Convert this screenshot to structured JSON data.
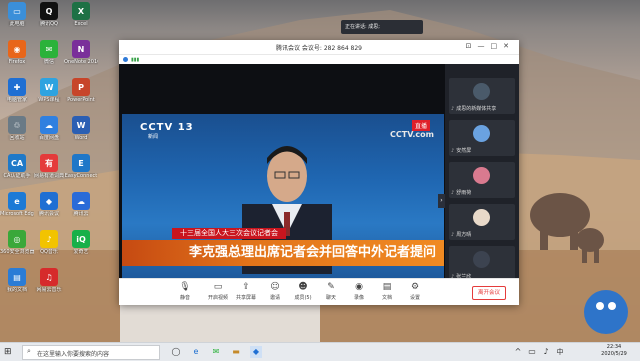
{
  "desktop_icons": [
    {
      "label": "此电脑",
      "glyph": "▭",
      "color": "#3b8fd9"
    },
    {
      "label": "腾讯QQ",
      "glyph": "Q",
      "color": "#111"
    },
    {
      "label": "Excel",
      "glyph": "X",
      "color": "#1e7145"
    },
    {
      "label": "Firefox",
      "glyph": "◉",
      "color": "#e8661a"
    },
    {
      "label": "微信",
      "glyph": "✉",
      "color": "#2bb23a"
    },
    {
      "label": "OneNote 2016",
      "glyph": "N",
      "color": "#7a2f9a"
    },
    {
      "label": "电脑管家",
      "glyph": "✚",
      "color": "#1f6fd3"
    },
    {
      "label": "WPS课程",
      "glyph": "W",
      "color": "#2ea3e0"
    },
    {
      "label": "PowerPoint",
      "glyph": "P",
      "color": "#c7452a"
    },
    {
      "label": "回收站",
      "glyph": "♲",
      "color": "#6a7a86"
    },
    {
      "label": "百度网盘",
      "glyph": "☁",
      "color": "#2f80e0"
    },
    {
      "label": "Word",
      "glyph": "W",
      "color": "#2b5fb3"
    },
    {
      "label": "CA认证助手",
      "glyph": "CA",
      "color": "#1f79c8"
    },
    {
      "label": "网易有道词典",
      "glyph": "有",
      "color": "#e43b3b"
    },
    {
      "label": "EasyConnect",
      "glyph": "E",
      "color": "#1f77c8"
    },
    {
      "label": "Microsoft Edge",
      "glyph": "e",
      "color": "#1c7ad6"
    },
    {
      "label": "腾讯会议",
      "glyph": "◆",
      "color": "#1f6fd3"
    },
    {
      "label": "腾讯云",
      "glyph": "☁",
      "color": "#2a6bd8"
    },
    {
      "label": "360安全浏览器",
      "glyph": "◎",
      "color": "#3aa83a"
    },
    {
      "label": "QQ音乐",
      "glyph": "♪",
      "color": "#f2c300"
    },
    {
      "label": "爱奇艺",
      "glyph": "iQ",
      "color": "#17b049"
    },
    {
      "label": "我的文档",
      "glyph": "▤",
      "color": "#2a7cd6"
    },
    {
      "label": "网易云音乐",
      "glyph": "♫",
      "color": "#d62b2b"
    }
  ],
  "window": {
    "title": "腾讯会议 会议号: 282 864 829",
    "speaking": "正在讲话: 成思;",
    "video": {
      "channel": "CCTV 13",
      "channel_sub": "新闻",
      "live": "直播",
      "watermark": "CCTV.com",
      "banner_small": "十三届全国人大三次会议记者会",
      "banner_big": "李克强总理出席记者会并回答中外记者提问"
    },
    "participants": [
      {
        "name": "成思的新媒体共享",
        "color": "#4a5a6a"
      },
      {
        "name": "安然屏",
        "color": "#6aa2e0"
      },
      {
        "name": "舒雨荷",
        "color": "#d97a8f"
      },
      {
        "name": "周方晴",
        "color": "#e8d9c9"
      },
      {
        "name": "张兰欣",
        "color": "#3c4350"
      }
    ],
    "toolbar": [
      {
        "label": "静音",
        "icon": "🎙"
      },
      {
        "label": "开启视频",
        "icon": "▭"
      },
      {
        "label": "共享屏幕",
        "icon": "⇪"
      },
      {
        "label": "邀请",
        "icon": "☺"
      },
      {
        "label": "成员(5)",
        "icon": "☻"
      },
      {
        "label": "聊天",
        "icon": "✎"
      },
      {
        "label": "录像",
        "icon": "◉"
      },
      {
        "label": "文档",
        "icon": "▤"
      },
      {
        "label": "设置",
        "icon": "⚙"
      }
    ],
    "leave_label": "离开会议"
  },
  "taskbar": {
    "search_placeholder": "在这里输入你要搜索的内容",
    "time": "22:34",
    "date": "2020/5/29"
  }
}
